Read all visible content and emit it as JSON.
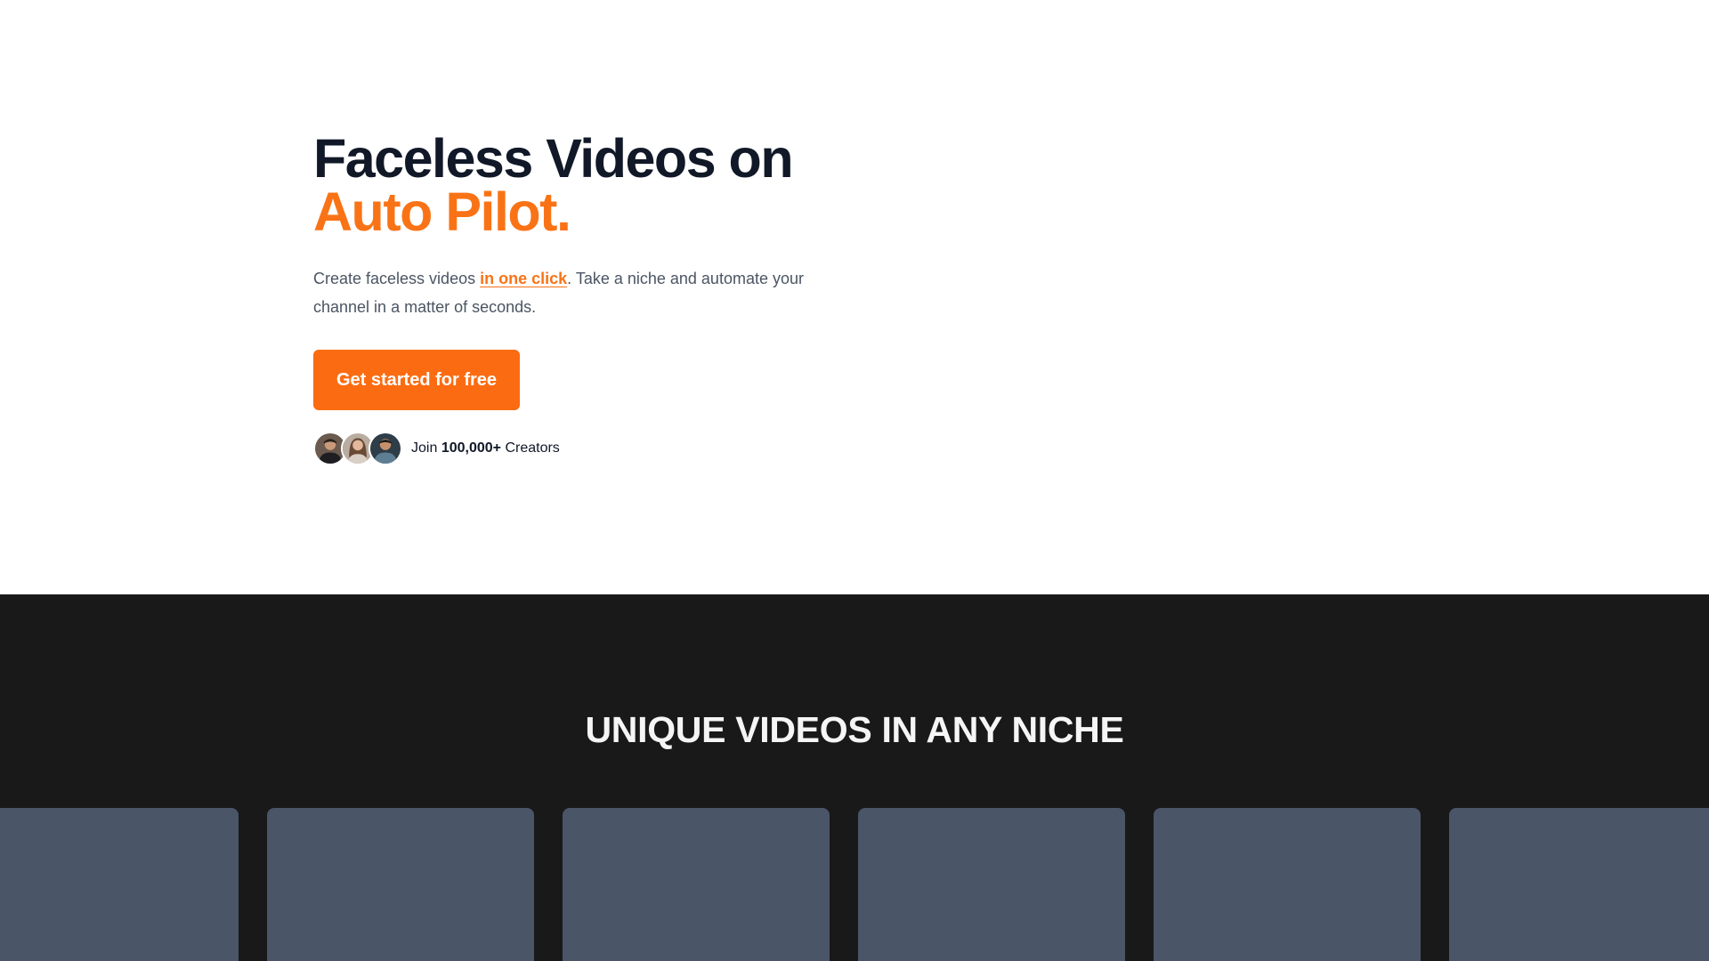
{
  "hero": {
    "headline_line1": "Faceless Videos on",
    "headline_line2": "Auto Pilot.",
    "subtext_before": "Create faceless videos ",
    "subtext_highlight": "in one click",
    "subtext_after": ". Take a niche and automate your channel in a matter of seconds.",
    "cta_label": "Get started for free",
    "social_proof": {
      "join_prefix": "Join",
      "count": "100,000+",
      "suffix": "Creators"
    }
  },
  "niche_section": {
    "title": "UNIQUE VIDEOS IN ANY NICHE",
    "card_count": 6
  },
  "colors": {
    "accent": "#f97316",
    "cta_background": "#fb6c12",
    "headline": "#111827",
    "section_background": "#191919",
    "card_placeholder": "#4a5568"
  }
}
